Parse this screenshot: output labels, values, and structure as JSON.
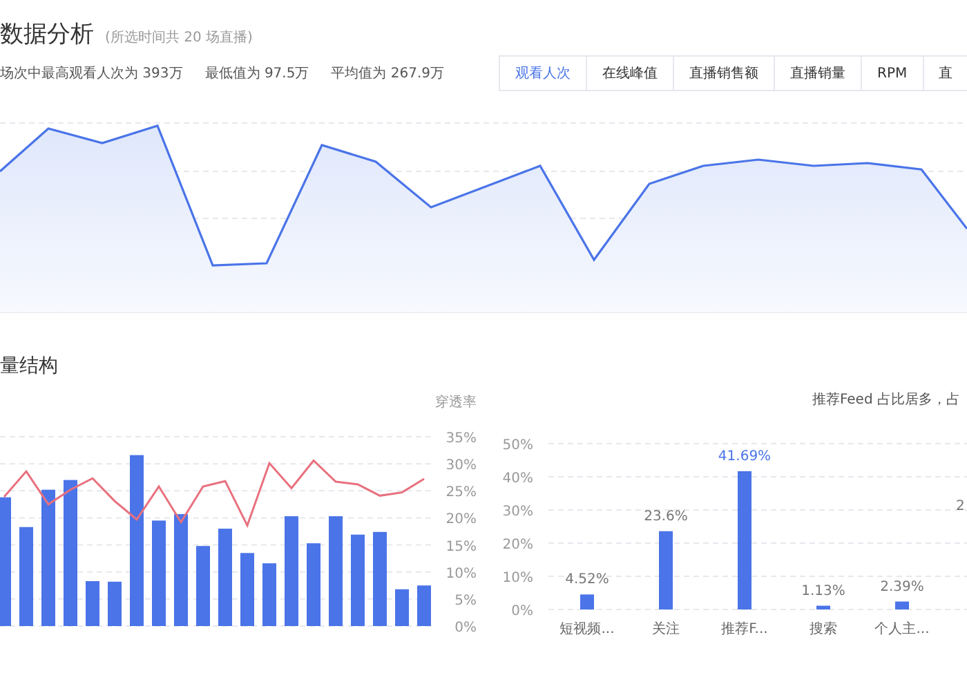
{
  "header": {
    "title": "数据分析",
    "subtitle": "(所选时间共 20 场直播)"
  },
  "stats": [
    "场次中最高观看人次为 393万",
    "最低值为 97.5万",
    "平均值为 267.9万"
  ],
  "tabs": [
    {
      "label": "观看人次",
      "selected": true
    },
    {
      "label": "在线峰值",
      "selected": false
    },
    {
      "label": "直播销售额",
      "selected": false
    },
    {
      "label": "直播销量",
      "selected": false
    },
    {
      "label": "RPM",
      "selected": false
    },
    {
      "label": "直",
      "selected": false
    }
  ],
  "section": {
    "title": "量结构"
  },
  "penetration_chart": {
    "chart_data": {
      "type": "bar",
      "grid": true,
      "ylim": [
        0,
        35
      ],
      "yticks": [
        {
          "value": 0,
          "label": "0%"
        },
        {
          "value": 5,
          "label": "5%"
        },
        {
          "value": 10,
          "label": "10%"
        },
        {
          "value": 15,
          "label": "15%"
        },
        {
          "value": 20,
          "label": "20%"
        },
        {
          "value": 25,
          "label": "25%"
        },
        {
          "value": 30,
          "label": "30%"
        },
        {
          "value": 35,
          "label": "35%"
        }
      ],
      "series": [
        {
          "type": "bar",
          "color": "#4a74e8",
          "values": [
            23.8,
            18.3,
            25.2,
            27.0,
            8.3,
            8.2,
            31.6,
            19.5,
            20.7,
            14.8,
            18.0,
            13.5,
            11.6,
            20.3,
            15.3,
            20.3,
            16.9,
            17.4,
            6.8,
            7.5
          ]
        },
        {
          "type": "line",
          "name": "穿透率",
          "color": "#e8707e",
          "values": [
            23.9,
            28.6,
            22.5,
            25.2,
            27.3,
            23.1,
            19.7,
            25.8,
            19.2,
            25.8,
            26.8,
            18.6,
            30.1,
            25.5,
            30.6,
            26.7,
            26.2,
            24.1,
            24.7,
            27.2
          ]
        }
      ]
    }
  },
  "source_chart": {
    "note": "推荐Feed 占比居多，占",
    "chart_data": {
      "type": "bar",
      "grid": true,
      "categories": [
        "短视频...",
        "关注",
        "推荐F...",
        "搜索",
        "个人主..."
      ],
      "values": [
        4.52,
        23.6,
        41.69,
        1.13,
        2.39
      ],
      "value_labels": [
        "4.52%",
        "23.6%",
        "41.69%",
        "1.13%",
        "2.39%"
      ],
      "ylim": [
        0,
        50
      ],
      "yticks": [
        {
          "value": 0,
          "label": "0%"
        },
        {
          "value": 10,
          "label": "10%"
        },
        {
          "value": 20,
          "label": "20%"
        },
        {
          "value": 30,
          "label": "30%"
        },
        {
          "value": 40,
          "label": "40%"
        },
        {
          "value": 50,
          "label": "50%"
        }
      ],
      "annotations": [
        {
          "text": "2"
        }
      ]
    }
  }
}
